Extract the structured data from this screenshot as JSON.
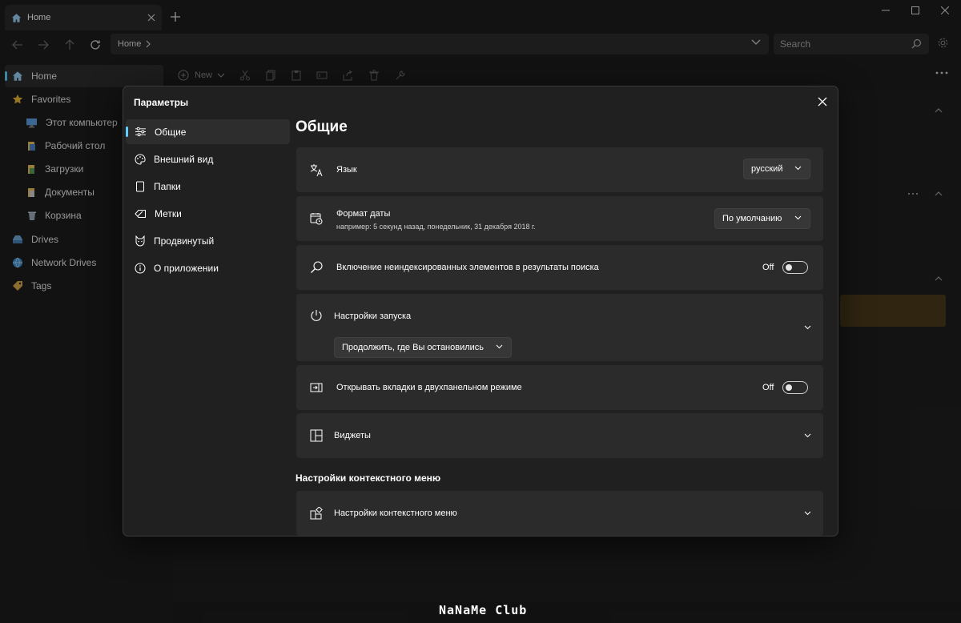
{
  "window": {
    "tab_title": "Home",
    "new_tab": "+",
    "address_crumb": "Home",
    "search_placeholder": "Search"
  },
  "explorer": {
    "toolbar": {
      "new_label": "New"
    },
    "sidebar": [
      {
        "label": "Home",
        "icon": "home-icon"
      },
      {
        "label": "Favorites",
        "icon": "star-icon"
      },
      {
        "label": "Этот компьютер",
        "icon": "monitor-icon"
      },
      {
        "label": "Рабочий стол",
        "icon": "folder-icon"
      },
      {
        "label": "Загрузки",
        "icon": "folder-icon"
      },
      {
        "label": "Документы",
        "icon": "folder-icon"
      },
      {
        "label": "Корзина",
        "icon": "recycle-bin-icon"
      },
      {
        "label": "Drives",
        "icon": "drive-icon"
      },
      {
        "label": "Network Drives",
        "icon": "network-icon"
      },
      {
        "label": "Tags",
        "icon": "tag-icon"
      }
    ]
  },
  "settings": {
    "title": "Параметры",
    "nav": [
      {
        "label": "Общие",
        "icon": "sliders-icon"
      },
      {
        "label": "Внешний вид",
        "icon": "palette-icon"
      },
      {
        "label": "Папки",
        "icon": "folder-outline-icon"
      },
      {
        "label": "Метки",
        "icon": "tag-outline-icon"
      },
      {
        "label": "Продвинутый",
        "icon": "cat-icon"
      },
      {
        "label": "О приложении",
        "icon": "info-icon"
      }
    ],
    "heading": "Общие",
    "language": {
      "label": "Язык",
      "value": "русский"
    },
    "date_format": {
      "label": "Формат даты",
      "example": "например: 5 секунд назад, понедельник, 31 декабря 2018 г.",
      "value": "По умолчанию"
    },
    "unindexed": {
      "label": "Включение неиндексированных элементов в результаты поиска",
      "state": "Off"
    },
    "startup": {
      "label": "Настройки запуска",
      "value": "Продолжить, где Вы остановились"
    },
    "dual_pane": {
      "label": "Открывать вкладки в двухпанельном режиме",
      "state": "Off"
    },
    "widgets": {
      "label": "Виджеты"
    },
    "context_heading": "Настройки контекстного меню",
    "context_menu": {
      "label": "Настройки контекстного меню"
    }
  },
  "watermark": "NaNaMe Club",
  "colors": {
    "accent": "#60cdff",
    "card": "#2b2b2b",
    "dialog": "#202020",
    "highlight": "#4a3a1a"
  }
}
